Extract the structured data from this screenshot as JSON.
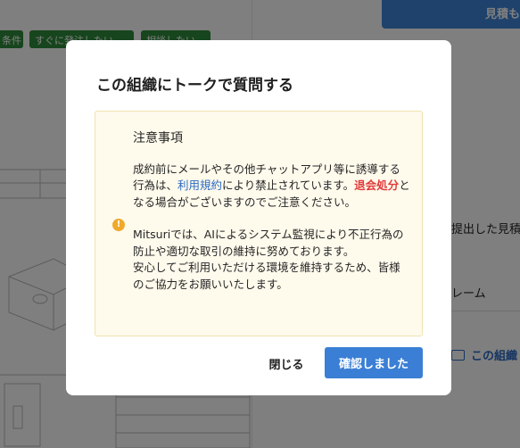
{
  "background": {
    "quote_button": "見積も",
    "tags": [
      "条件",
      "すぐに発注したい",
      "相談したい"
    ],
    "side_text_1": "提出した見積",
    "side_text_2": "レーム",
    "chat_link": "この組織"
  },
  "modal": {
    "title": "この組織にトークで質問する",
    "notice": {
      "title": "注意事項",
      "p1_a": "成約前にメールやその他チャットアプリ等に誘導する行為は、",
      "p1_link": "利用規約",
      "p1_b": "により禁止されています。",
      "p1_danger": "退会処分",
      "p1_c": "となる場合がございますのでご注意ください。",
      "p2": "Mitsuriでは、AIによるシステム監視により不正行為の防止や適切な取引の維持に努めております。",
      "p3": "安心してご利用いただける環境を維持するため、皆様のご協力をお願いいたします。"
    },
    "close_label": "閉じる",
    "confirm_label": "確認しました"
  },
  "colors": {
    "primary": "#3a7fd5",
    "warning": "#f0a92b",
    "danger": "#e23b3b",
    "link": "#2a6bc2",
    "tag_green": "#2f8a3a",
    "notice_bg": "#fefaec"
  }
}
